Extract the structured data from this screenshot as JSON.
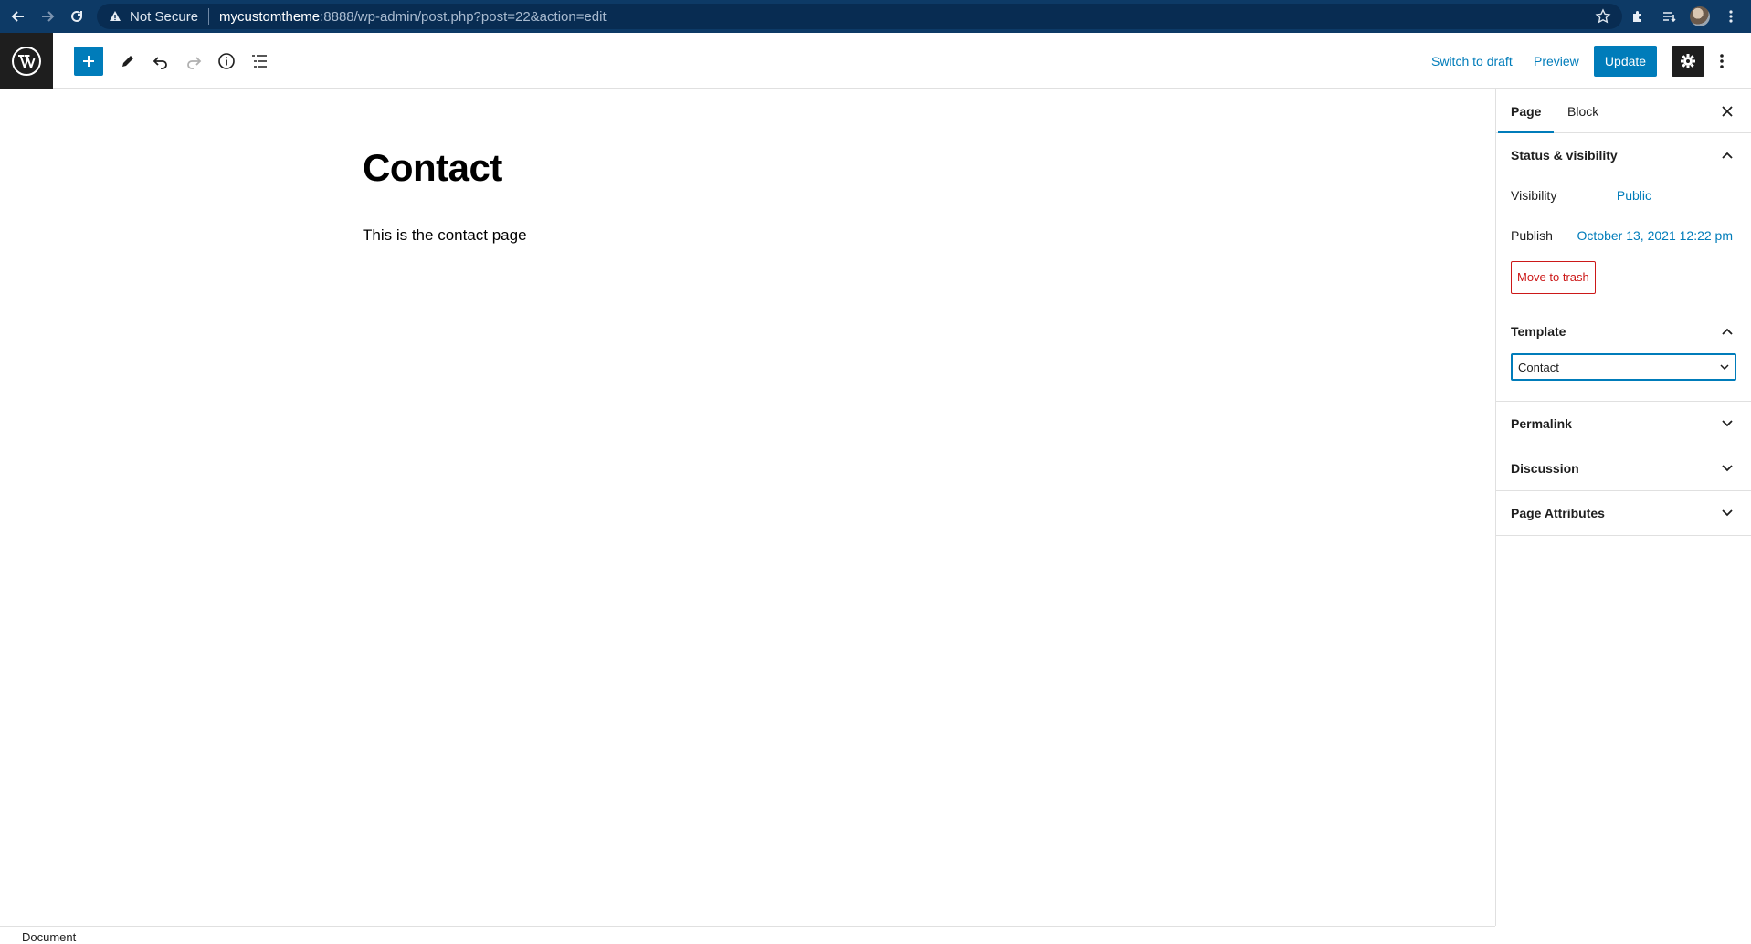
{
  "browser": {
    "not_secure": "Not Secure",
    "url_host": "mycustomtheme",
    "url_path": ":8888/wp-admin/post.php?post=22&action=edit"
  },
  "toolbar": {
    "switch_to_draft": "Switch to draft",
    "preview": "Preview",
    "update": "Update"
  },
  "editor": {
    "title": "Contact",
    "paragraph": "This is the contact page"
  },
  "sidebar": {
    "tabs": [
      "Page",
      "Block"
    ],
    "status_visibility": {
      "heading": "Status & visibility",
      "visibility_label": "Visibility",
      "visibility_value": "Public",
      "publish_label": "Publish",
      "publish_value": "October 13, 2021 12:22 pm",
      "trash": "Move to trash"
    },
    "template": {
      "heading": "Template",
      "selected": "Contact"
    },
    "panels": [
      "Permalink",
      "Discussion",
      "Page Attributes"
    ]
  },
  "footer": {
    "breadcrumb": "Document"
  },
  "colors": {
    "accent": "#007cba",
    "danger": "#cc1818",
    "browser_bar": "#0d3a66"
  }
}
